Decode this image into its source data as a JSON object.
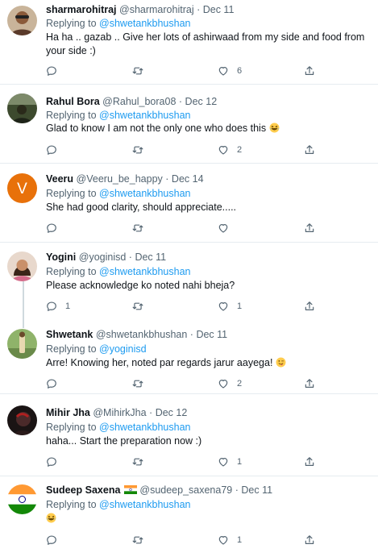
{
  "replies_prefix": "Replying to",
  "tweets": [
    {
      "name": "sharmarohitraj",
      "handle": "@sharmarohitraj",
      "sep": "·",
      "date": "Dec 11",
      "replying_to": "@shwetankbhushan",
      "text": "Ha ha .. gazab .. Give her lots of ashirwaad from my side and food from your side :)",
      "likes": "6",
      "replies_count": "",
      "avatar_color": "#b05a3c"
    },
    {
      "name": "Rahul Bora",
      "handle": "@Rahul_bora08",
      "sep": "·",
      "date": "Dec 12",
      "replying_to": "@shwetankbhushan",
      "text": "Glad to know I am not the only one who does this",
      "likes": "2",
      "replies_count": "",
      "avatar_color": "#3d4a2e"
    },
    {
      "name": "Veeru",
      "handle": "@Veeru_be_happy",
      "sep": "·",
      "date": "Dec 14",
      "replying_to": "@shwetankbhushan",
      "text": "She had good clarity, should appreciate.....",
      "likes": "",
      "replies_count": "",
      "avatar_letter": "V",
      "avatar_color": "#e8710a"
    },
    {
      "name": "Yogini",
      "handle": "@yoginisd",
      "sep": "·",
      "date": "Dec 11",
      "replying_to": "@shwetankbhushan",
      "text": "Please acknowledge ko noted nahi bheja?",
      "likes": "1",
      "replies_count": "1",
      "avatar_color": "#c9a48c"
    },
    {
      "name": "Shwetank",
      "handle": "@shwetankbhushan",
      "sep": "·",
      "date": "Dec 11",
      "replying_to": "@yoginisd",
      "text": "Arre! Knowing her, noted par regards jarur aayega!",
      "likes": "2",
      "replies_count": "",
      "avatar_color": "#7a9a5a"
    },
    {
      "name": "Mihir Jha",
      "handle": "@MihirkJha",
      "sep": "·",
      "date": "Dec 12",
      "replying_to": "@shwetankbhushan",
      "text": "haha... Start the preparation now :)",
      "likes": "1",
      "replies_count": "",
      "avatar_color": "#2a1a1a"
    },
    {
      "name": "Sudeep Saxena",
      "handle": "@sudeep_saxena79",
      "sep": "·",
      "date": "Dec 11",
      "replying_to": "@shwetankbhushan",
      "text": "",
      "likes": "1",
      "replies_count": "",
      "avatar_color": "#ff9933"
    }
  ],
  "colors": {
    "link": "#1d9bf0",
    "muted": "#536471",
    "text": "#0f1419",
    "divider": "#e6ecf0"
  },
  "icons": [
    "reply-icon",
    "retweet-icon",
    "like-icon",
    "share-icon",
    "laughing-emoji-icon",
    "winking-tongue-emoji-icon",
    "india-flag-icon"
  ]
}
